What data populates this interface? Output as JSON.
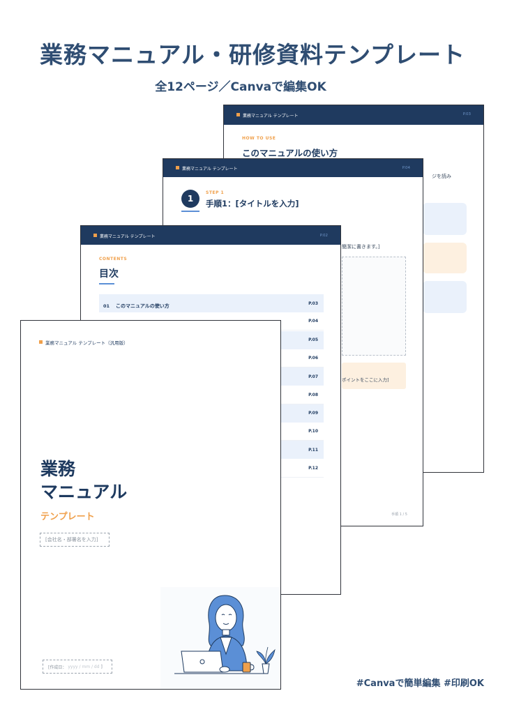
{
  "header": {
    "title": "業務マニュアル・研修資料テンプレート",
    "subtitle": "全12ページ／Canvaで編集OK"
  },
  "footer": {
    "hashtags": "#Canvaで簡単編集  #印刷OK"
  },
  "colors": {
    "navy": "#1f3a5f",
    "accent_orange": "#f0a04b",
    "accent_blue": "#5b8fd6",
    "pale_blue": "#eaf1fb",
    "pale_orange": "#fdf0e0"
  },
  "page4": {
    "header_label": "業務マニュアル テンプレート",
    "page_no": "P.03",
    "eyebrow": "HOW TO USE",
    "title": "このマニュアルの使い方",
    "body_fragment": "ジを読み"
  },
  "page3": {
    "header_label": "業務マニュアル テンプレート",
    "page_no": "P.04",
    "step_number": "1",
    "eyebrow": "STEP 1",
    "title": "手順1：[タイトルを入力]",
    "body_fragment": "簡潔に書きます。]",
    "tip_fragment": "ポイントをここに入力]",
    "footer": "手順 1 / 5"
  },
  "page2": {
    "header_label": "業務マニュアル テンプレート",
    "page_no": "P.02",
    "eyebrow": "CONTENTS",
    "title": "目次",
    "toc": [
      {
        "no": "01",
        "label": "このマニュアルの使い方",
        "page": "P.03"
      },
      {
        "no": "",
        "label": "",
        "page": "P.04"
      },
      {
        "no": "",
        "label": "",
        "page": "P.05"
      },
      {
        "no": "",
        "label": "",
        "page": "P.06"
      },
      {
        "no": "",
        "label": "",
        "page": "P.07"
      },
      {
        "no": "",
        "label": "",
        "page": "P.08"
      },
      {
        "no": "",
        "label": "",
        "page": "P.09"
      },
      {
        "no": "",
        "label": "",
        "page": "P.10"
      },
      {
        "no": "",
        "label": "",
        "page": "P.11"
      },
      {
        "no": "",
        "label": "",
        "page": "P.12"
      }
    ]
  },
  "page1": {
    "header_label": "業務マニュアル テンプレート（汎用版）",
    "title_line1": "業務",
    "title_line2": "マニュアル",
    "subtitle": "テンプレート",
    "company_placeholder": "[会社名・部署名を入力]",
    "date_label": "[作成日：",
    "date_placeholder": "yyyy / mm / dd",
    "date_suffix": "]"
  }
}
